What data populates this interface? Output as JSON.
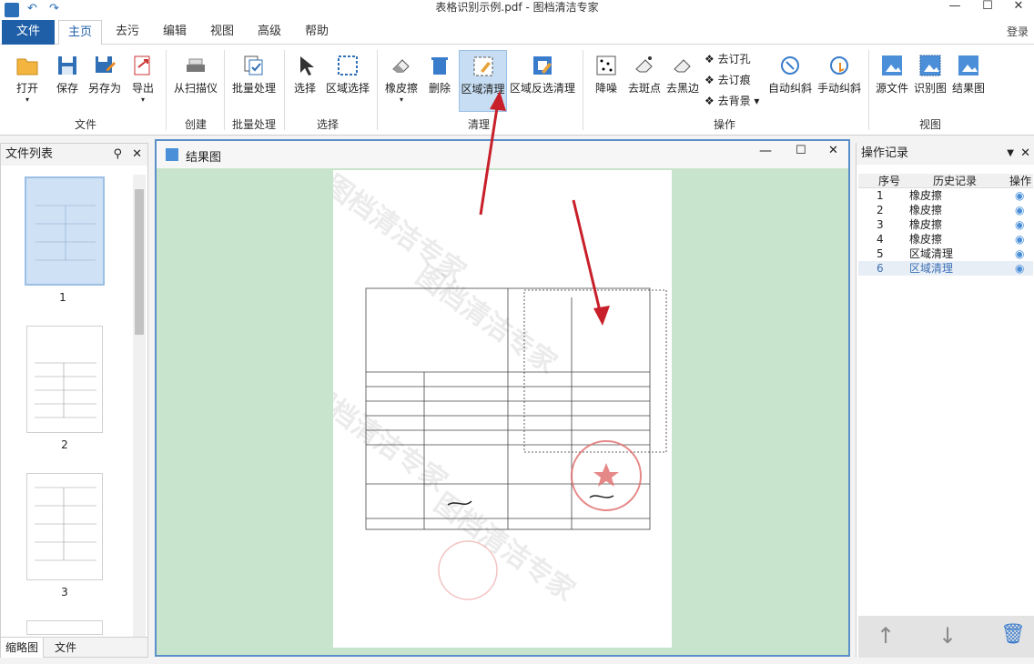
{
  "app": {
    "title": "表格识别示例.pdf - 图档清洁专家"
  },
  "tabs": [
    "文件",
    "主页",
    "去污",
    "编辑",
    "视图",
    "高级",
    "帮助"
  ],
  "login": "登录",
  "ribbon": {
    "file": [
      "打开",
      "保存",
      "另存为",
      "导出"
    ],
    "file_group": "文件",
    "create": "从扫描仪",
    "create_group": "创建",
    "batch": "批量处理",
    "batch_group": "批量处理",
    "select": [
      "选择",
      "区域选择"
    ],
    "select_group": "选择",
    "clean": [
      "橡皮擦",
      "删除",
      "区域清理",
      "区域反选清理"
    ],
    "clean_group": "清理",
    "ops": [
      "降噪",
      "去斑点",
      "去黑边"
    ],
    "ops_small": [
      "去订孔",
      "去订痕",
      "去背景"
    ],
    "ops_big": [
      "自动纠斜",
      "手动纠斜"
    ],
    "ops_group": "操作",
    "view": [
      "源文件",
      "识别图",
      "结果图"
    ],
    "view_group": "视图"
  },
  "left_panel": {
    "title": "文件列表",
    "pages": [
      "1",
      "2",
      "3"
    ],
    "tabs": [
      "缩略图",
      "文件"
    ]
  },
  "doc_window": {
    "title": "结果图",
    "watermark": "图档清洁专家"
  },
  "right_panel": {
    "title": "操作记录",
    "columns": [
      "序号",
      "历史记录",
      "操作"
    ],
    "rows": [
      {
        "n": "1",
        "op": "橡皮擦"
      },
      {
        "n": "2",
        "op": "橡皮擦"
      },
      {
        "n": "3",
        "op": "橡皮擦"
      },
      {
        "n": "4",
        "op": "橡皮擦"
      },
      {
        "n": "5",
        "op": "区域清理"
      },
      {
        "n": "6",
        "op": "区域清理"
      }
    ]
  },
  "colors": {
    "accent": "#1f5fa8",
    "highlight": "#c6ddf3",
    "canvas": "#c8e4cc",
    "arrow": "#c8202a"
  }
}
